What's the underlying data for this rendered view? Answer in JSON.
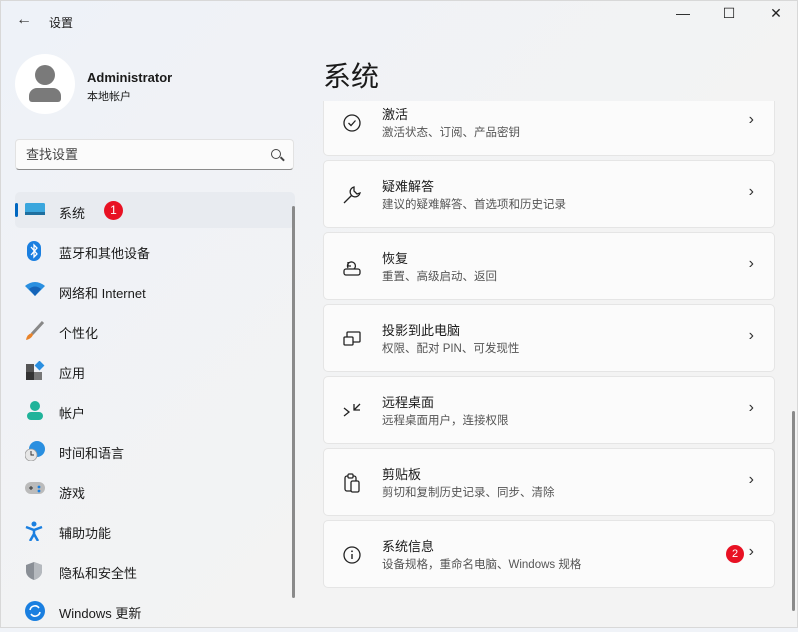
{
  "window": {
    "title": "设置",
    "minimize": "—",
    "maximize": "☐",
    "close": "✕",
    "back": "←"
  },
  "profile": {
    "name": "Administrator",
    "account_type": "本地帐户"
  },
  "search": {
    "placeholder": "查找设置"
  },
  "nav": [
    {
      "label": "系统",
      "icon": "monitor-icon",
      "badge": "1",
      "active": true
    },
    {
      "label": "蓝牙和其他设备",
      "icon": "bluetooth-icon"
    },
    {
      "label": "网络和 Internet",
      "icon": "wifi-icon"
    },
    {
      "label": "个性化",
      "icon": "brush-icon"
    },
    {
      "label": "应用",
      "icon": "apps-icon"
    },
    {
      "label": "帐户",
      "icon": "person-icon"
    },
    {
      "label": "时间和语言",
      "icon": "globe-clock-icon"
    },
    {
      "label": "游戏",
      "icon": "gamepad-icon"
    },
    {
      "label": "辅助功能",
      "icon": "accessibility-icon"
    },
    {
      "label": "隐私和安全性",
      "icon": "shield-icon"
    },
    {
      "label": "Windows 更新",
      "icon": "update-icon"
    }
  ],
  "page_title": "系统",
  "cards": [
    {
      "title": "激活",
      "subtitle": "激活状态、订阅、产品密钥",
      "icon": "check-circle-icon"
    },
    {
      "title": "疑难解答",
      "subtitle": "建议的疑难解答、首选项和历史记录",
      "icon": "wrench-icon"
    },
    {
      "title": "恢复",
      "subtitle": "重置、高级启动、返回",
      "icon": "recovery-icon"
    },
    {
      "title": "投影到此电脑",
      "subtitle": "权限、配对 PIN、可发现性",
      "icon": "project-icon"
    },
    {
      "title": "远程桌面",
      "subtitle": "远程桌面用户，连接权限",
      "icon": "remote-desktop-icon"
    },
    {
      "title": "剪贴板",
      "subtitle": "剪切和复制历史记录、同步、清除",
      "icon": "clipboard-icon"
    },
    {
      "title": "系统信息",
      "subtitle": "设备规格，重命名电脑、Windows 规格",
      "icon": "info-icon",
      "badge": "2"
    }
  ]
}
